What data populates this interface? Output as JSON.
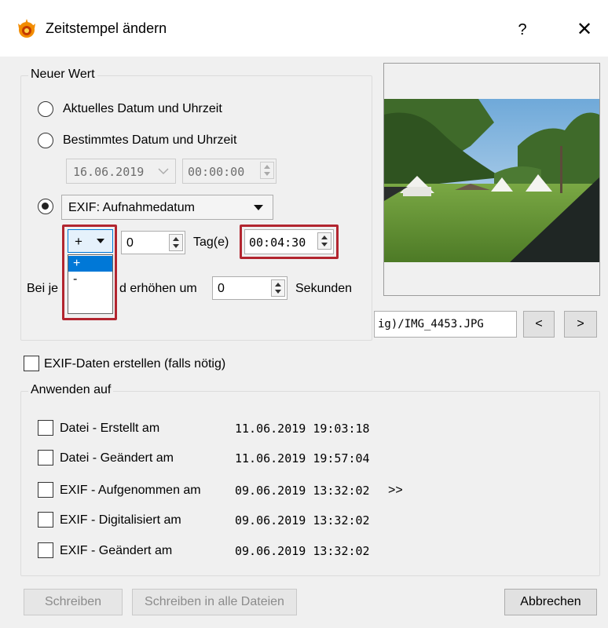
{
  "window": {
    "title": "Zeitstempel ändern",
    "help_label": "?",
    "close_label": "✕",
    "accent_color": "#0078d7",
    "highlight_color": "#b2252f"
  },
  "new_value": {
    "legend": "Neuer Wert",
    "option_current": "Aktuelles Datum und Uhrzeit",
    "option_specific": "Bestimmtes Datum und Uhrzeit",
    "specific_date": "16.06.2019",
    "specific_time": "00:00:00",
    "exif_source": "EXIF: Aufnahmedatum",
    "sign_selected": "+",
    "sign_options": [
      "+",
      "-"
    ],
    "days_value": "0",
    "days_label": "Tag(e)",
    "offset_time": "00:04:30",
    "increment_prefix": "Bei je",
    "increment_middle": "d erhöhen um",
    "increment_value": "0",
    "increment_unit": "Sekunden"
  },
  "preview": {
    "filename": "ig)/IMG_4453.JPG",
    "prev_label": "<",
    "next_label": ">"
  },
  "create_exif_label": "EXIF-Daten erstellen (falls nötig)",
  "apply_to": {
    "legend": "Anwenden auf",
    "rows": [
      {
        "label": "Datei - Erstellt am",
        "value": "11.06.2019 19:03:18"
      },
      {
        "label": "Datei - Geändert am",
        "value": "11.06.2019 19:57:04"
      },
      {
        "label": "EXIF - Aufgenommen am",
        "value": "09.06.2019 13:32:02",
        "extra": ">>"
      },
      {
        "label": "EXIF - Digitalisiert am",
        "value": "09.06.2019 13:32:02"
      },
      {
        "label": "EXIF - Geändert am",
        "value": "09.06.2019 13:32:02"
      }
    ]
  },
  "buttons": {
    "write": "Schreiben",
    "write_all": "Schreiben in alle Dateien",
    "cancel": "Abbrechen"
  }
}
